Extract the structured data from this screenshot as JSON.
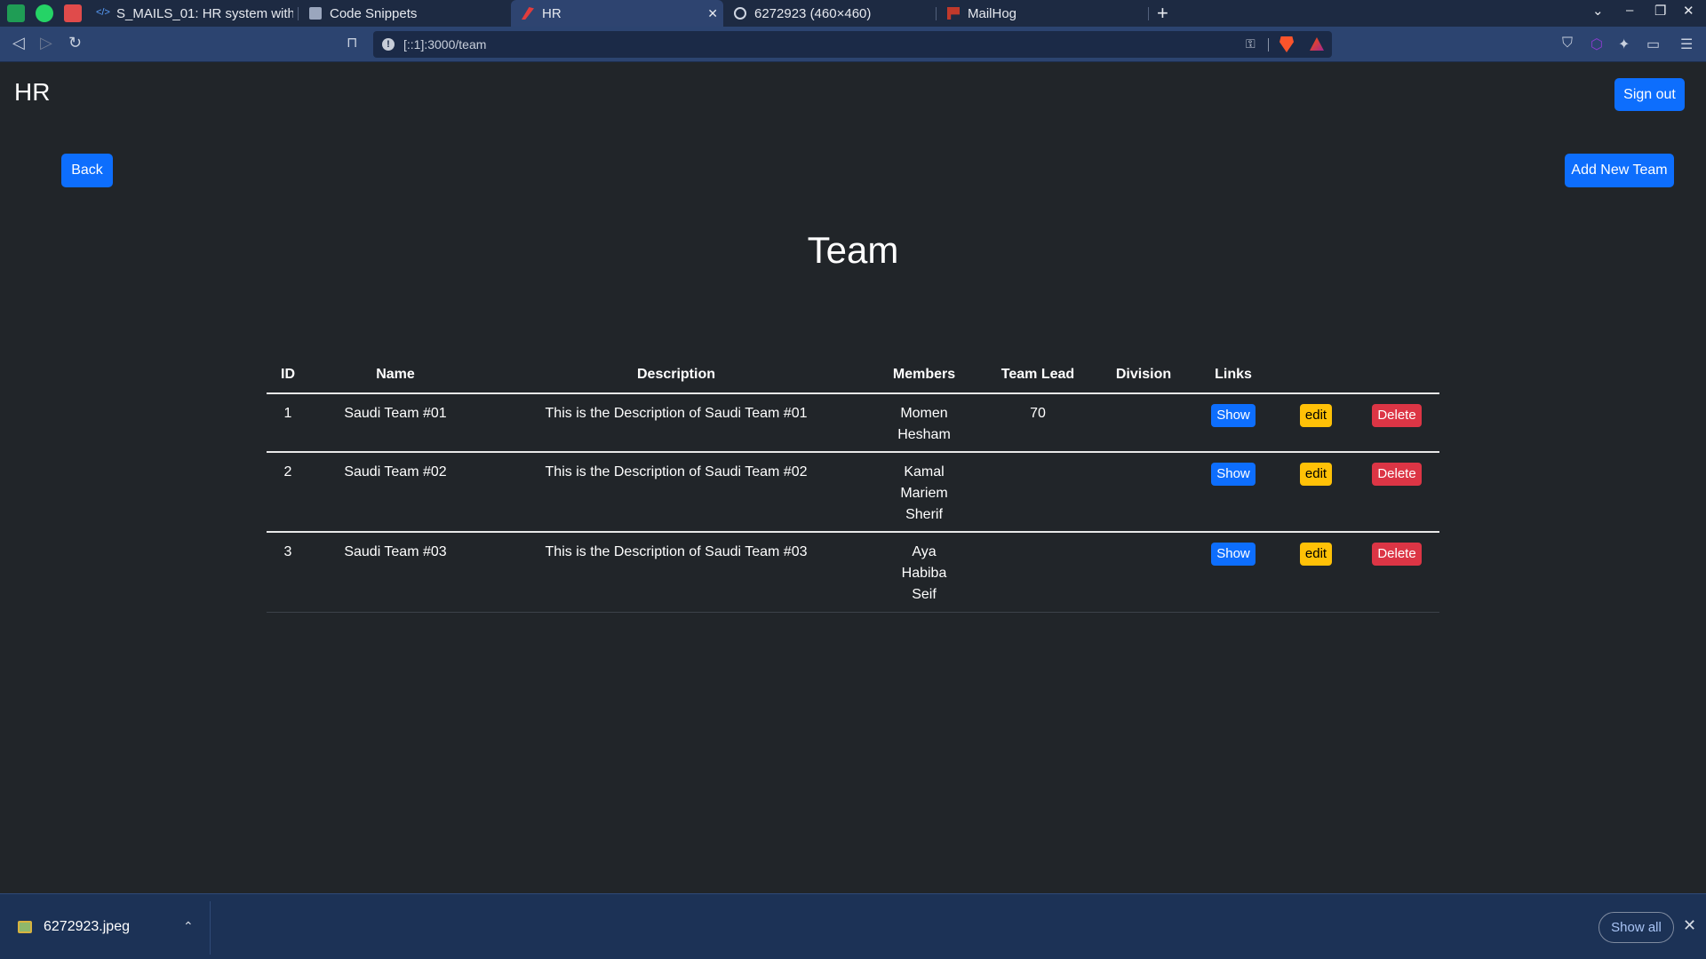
{
  "browser": {
    "tabs": [
      {
        "title": "S_MAILS_01: HR system with m",
        "active": false
      },
      {
        "title": "Code Snippets",
        "active": false
      },
      {
        "title": "HR",
        "active": true
      },
      {
        "title": "6272923 (460×460)",
        "active": false
      },
      {
        "title": "MailHog",
        "active": false
      }
    ],
    "new_tab": "+",
    "address": "[::1]:3000/team",
    "icons": {
      "back": "back-arrow-icon",
      "forward": "forward-arrow-icon",
      "reload": "reload-icon",
      "bookmark": "bookmark-icon",
      "site_info": "info-icon",
      "password_key": "key-icon",
      "brave_shields": "brave-lion-icon",
      "rewards": "bat-triangle-icon",
      "extensions": "puzzle-icon"
    }
  },
  "page": {
    "brand": "HR",
    "sign_out": "Sign out",
    "back": "Back",
    "add_new": "Add New Team",
    "title": "Team",
    "accent": "#0d6efd"
  },
  "table": {
    "headers": [
      "ID",
      "Name",
      "Description",
      "Members",
      "Team Lead",
      "Division",
      "Links"
    ],
    "rows": [
      {
        "id": "1",
        "name": "Saudi Team #01",
        "description": "This is the Description of Saudi Team #01",
        "members": [
          "Momen",
          "Hesham"
        ],
        "team_lead": "70",
        "division": "",
        "show": "Show",
        "edit": "edit",
        "delete": "Delete"
      },
      {
        "id": "2",
        "name": "Saudi Team #02",
        "description": "This is the Description of Saudi Team #02",
        "members": [
          "Kamal",
          "Mariem",
          "Sherif"
        ],
        "team_lead": "",
        "division": "",
        "show": "Show",
        "edit": "edit",
        "delete": "Delete"
      },
      {
        "id": "3",
        "name": "Saudi Team #03",
        "description": "This is the Description of Saudi Team #03",
        "members": [
          "Aya",
          "Habiba",
          "Seif"
        ],
        "team_lead": "",
        "division": "",
        "show": "Show",
        "edit": "edit",
        "delete": "Delete"
      }
    ]
  },
  "downloads": {
    "file": "6272923.jpeg",
    "show_all": "Show all"
  }
}
